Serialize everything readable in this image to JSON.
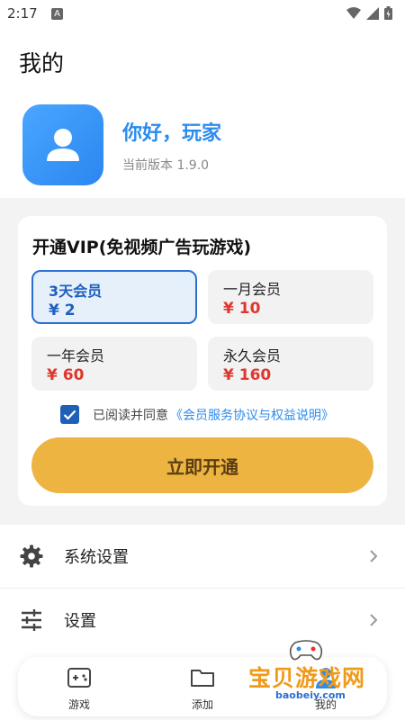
{
  "status_bar": {
    "time": "2:17",
    "a_badge": "A"
  },
  "header": {
    "title": "我的"
  },
  "profile": {
    "greeting": "你好，玩家",
    "version": "当前版本 1.9.0"
  },
  "vip": {
    "title": "开通VIP(免视频广告玩游戏)",
    "plans": [
      {
        "name": "3天会员",
        "price": "¥ 2",
        "selected": true
      },
      {
        "name": "一月会员",
        "price": "¥ 10",
        "selected": false
      },
      {
        "name": "一年会员",
        "price": "¥ 60",
        "selected": false
      },
      {
        "name": "永久会员",
        "price": "¥ 160",
        "selected": false
      }
    ],
    "agree_text": "已阅读并同意",
    "agree_link": "《会员服务协议与权益说明》",
    "agree_checked": true,
    "button_label": "立即开通"
  },
  "settings": {
    "items": [
      {
        "label": "系统设置",
        "icon": "gear-icon"
      },
      {
        "label": "设置",
        "icon": "sliders-icon"
      }
    ]
  },
  "bottom_nav": {
    "items": [
      {
        "label": "游戏",
        "icon": "gamepad-icon"
      },
      {
        "label": "添加",
        "icon": "folder-icon"
      },
      {
        "label": "我的",
        "icon": "user-icon"
      }
    ]
  },
  "watermark": {
    "text": "宝贝游戏网",
    "sub": "baobeiy.com"
  },
  "colors": {
    "accent": "#2b8cef",
    "price": "#e0362c",
    "button": "#edb442",
    "selected": "#1e5fbf"
  }
}
